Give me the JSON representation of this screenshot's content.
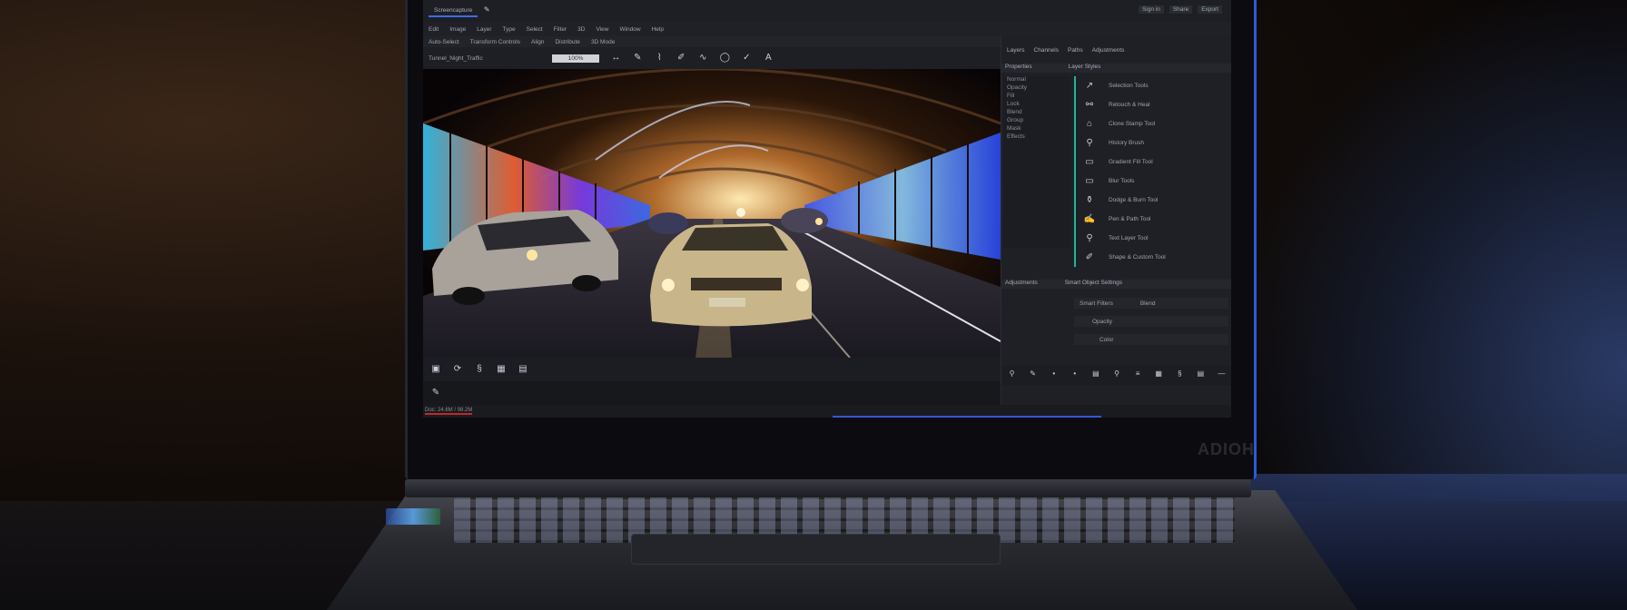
{
  "app": {
    "title_tab": "Screencapture",
    "brand": "ADIOH"
  },
  "titlebar": {
    "buttons": [
      "Sign in",
      "Share",
      "Export"
    ]
  },
  "menubar": {
    "items": [
      "Edit",
      "Image",
      "Layer",
      "Type",
      "Select",
      "Filter",
      "3D",
      "View",
      "Window",
      "Help"
    ]
  },
  "optionsbar": {
    "items": [
      "Auto-Select",
      "Transform Controls",
      "Align",
      "Distribute",
      "3D Mode"
    ]
  },
  "document": {
    "name": "Tunnel_Night_Traffic",
    "zoom_value": "100%"
  },
  "tools": [
    "↔",
    "✎",
    "⌇",
    "✐",
    "∿",
    "◯",
    "✓",
    "A"
  ],
  "canvas_tools": [
    "▣",
    "⟳",
    "§",
    "▦",
    "▤"
  ],
  "cmd": {
    "icon": "✎"
  },
  "panel": {
    "tabs": [
      "Layers",
      "Channels",
      "Paths",
      "Adjustments"
    ],
    "head": [
      "Properties",
      "Layer Styles"
    ],
    "left_list": [
      "Normal",
      "Opacity",
      "Fill",
      "Lock",
      "Blend",
      "Group",
      "Mask",
      "Effects"
    ],
    "items": [
      {
        "icon": "↗",
        "label": "Selection Tools"
      },
      {
        "icon": "⚯",
        "label": "Retouch & Heal"
      },
      {
        "icon": "⌂",
        "label": "Clone Stamp Tool"
      },
      {
        "icon": "⚲",
        "label": "History Brush"
      },
      {
        "icon": "▭",
        "label": "Gradient Fill Tool"
      },
      {
        "icon": "▭",
        "label": "Blur Tools"
      },
      {
        "icon": "⚱",
        "label": "Dodge & Burn Tool"
      },
      {
        "icon": "✍",
        "label": "Pen & Path Tool"
      },
      {
        "icon": "⚲",
        "label": "Text Layer Tool"
      },
      {
        "icon": "✐",
        "label": "Shape & Custom Tool"
      }
    ],
    "props_head": [
      "Adjustments",
      "Smart Object Settings"
    ],
    "props": [
      "Smart Filters",
      "Blend",
      "Opacity",
      "Color"
    ],
    "tools": [
      "⚲",
      "✎",
      "•",
      "•",
      "▤",
      "⚲",
      "≡",
      "▦",
      "§",
      "▤",
      "—"
    ]
  },
  "status": {
    "text": "Doc: 24.6M / 98.2M",
    "progress": 0.33
  }
}
